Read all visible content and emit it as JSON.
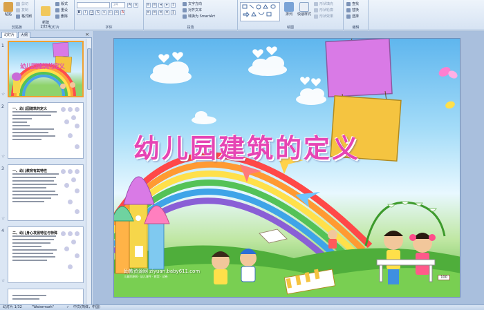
{
  "ribbon": {
    "groups": [
      {
        "label": "剪贴板"
      },
      {
        "label": "幻灯片"
      },
      {
        "label": "字体"
      },
      {
        "label": "段落"
      },
      {
        "label": "绘图"
      },
      {
        "label": "编辑"
      }
    ],
    "clipboard": {
      "paste": "粘贴",
      "cut": "剪切",
      "copy": "复制",
      "format_painter": "格式刷"
    },
    "slides": {
      "new_slide": "新建\n幻灯片",
      "layout": "版式",
      "reset": "重设",
      "delete": "删除"
    },
    "font": {
      "font_name": "",
      "font_size": "24"
    },
    "paragraph": {
      "text_direction": "文字方向",
      "align_text": "对齐文本",
      "convert_smartart": "转换为 SmartArt"
    },
    "drawing": {
      "arrange": "排列",
      "quick_styles": "快速样式",
      "shape_fill": "形状填充",
      "shape_outline": "形状轮廓",
      "shape_effects": "形状效果"
    },
    "editing": {
      "find": "查找",
      "replace": "替换",
      "select": "选择"
    }
  },
  "panel": {
    "tabs": [
      "幻灯片",
      "大纲"
    ],
    "close": "×",
    "thumbnails": [
      {
        "number": "1",
        "title": "幼儿园建筑的定义"
      },
      {
        "number": "2",
        "title": "一、幼儿园建筑的定义"
      },
      {
        "number": "3",
        "title": "一、幼儿教育有其特性"
      },
      {
        "number": "4",
        "title": "二、幼儿身心发展特征与特殊"
      }
    ]
  },
  "slide": {
    "title": "幼儿园建筑的定义",
    "watermark": "幼教资源网 ziyuan.baby611.com",
    "watermark_sub": "儿童资源网 · 幼儿课件 · 教案 · 试卷",
    "board_label": "100"
  },
  "status": {
    "slide_index": "幻灯片 1/32",
    "theme": "\"Watermark\"",
    "language": "中文(简体，中国)"
  }
}
